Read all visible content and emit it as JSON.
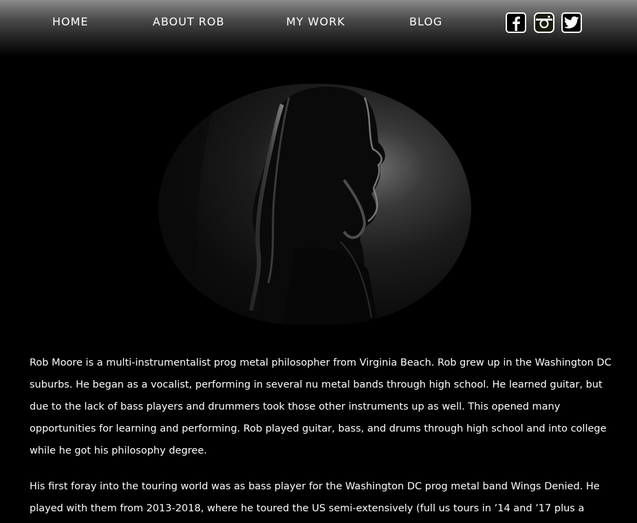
{
  "nav": {
    "home": "HOME",
    "about": "ABOUT ROB",
    "work": "MY WORK",
    "blog": "BLOG"
  },
  "social": {
    "facebook": "facebook-icon",
    "instagram": "instagram-icon",
    "twitter": "twitter-icon"
  },
  "colors": {
    "background": "#000000",
    "text": "#ffffff",
    "nav_gradient_top": "#8a8a8a"
  },
  "bio": {
    "paragraph_1": "Rob Moore is a multi-instrumentalist prog metal philosopher from Virginia Beach. Rob grew up in the Washington DC suburbs. He began as a vocalist, performing in several nu metal bands through high school. He learned guitar, but due to the lack of bass players and drummers took those other instruments up as well. This opened many opportunities for learning and performing. Rob played guitar, bass, and drums through high school and into college while he got his philosophy degree.",
    "paragraph_2": "His first foray into the touring world was as bass player for the Washington DC prog metal band Wings Denied. He played with them from 2013-2018, where he toured the US semi-extensively (full us tours in ’14 and ’17 plus a"
  }
}
